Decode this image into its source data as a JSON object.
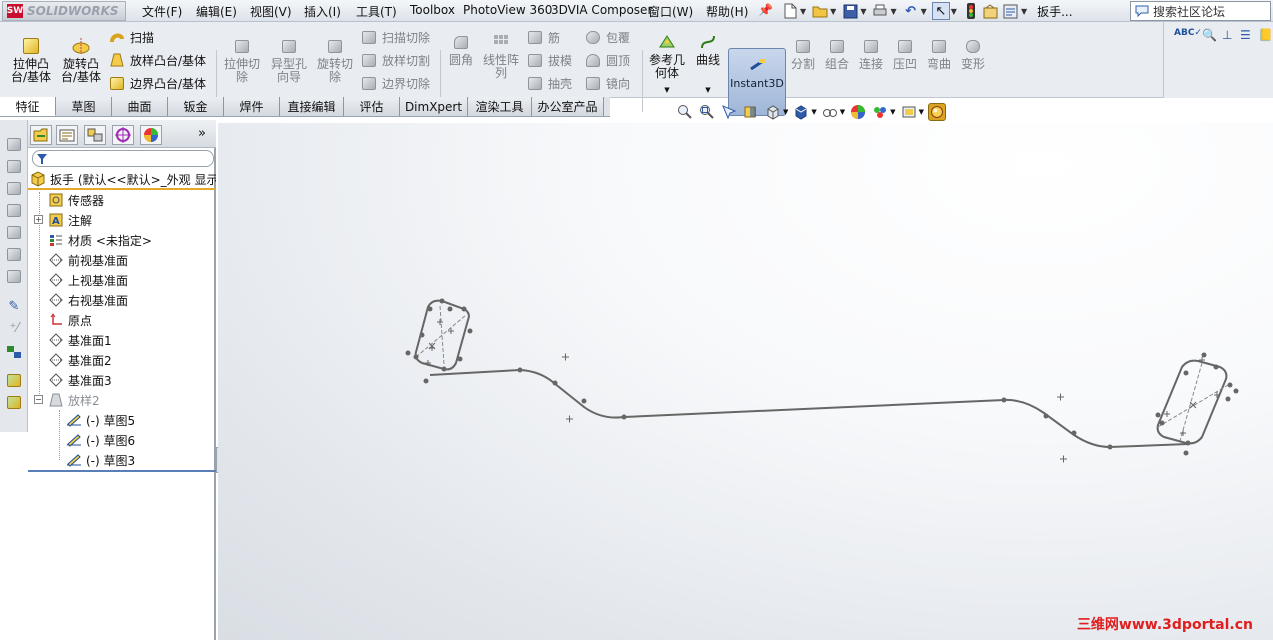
{
  "app": {
    "logo_text": "SOLIDWORKS",
    "logo_badge": "SW"
  },
  "menu": [
    "文件(F)",
    "编辑(E)",
    "视图(V)",
    "插入(I)",
    "工具(T)",
    "Toolbox",
    "PhotoView 360",
    "3DVIA Composer",
    "窗口(W)",
    "帮助(H)"
  ],
  "doc_title": "扳手...",
  "search": {
    "placeholder": "搜索社区论坛"
  },
  "commands": {
    "extrude_boss": "拉伸凸\n台/基体",
    "revolve_boss": "旋转凸\n台/基体",
    "sweep": "扫描",
    "loft_boss": "放样凸台/基体",
    "boundary_boss": "边界凸台/基体",
    "extrude_cut": "拉伸切\n除",
    "hole_wizard": "异型孔\n向导",
    "revolve_cut": "旋转切\n除",
    "swept_cut": "扫描切除",
    "lofted_cut": "放样切割",
    "boundary_cut": "边界切除",
    "fillet": "圆角",
    "linear_pattern": "线性阵\n列",
    "rib": "筋",
    "draft": "拔模",
    "shell": "抽壳",
    "wrap": "包覆",
    "dome": "圆顶",
    "mirror": "镜向",
    "ref_geometry": "参考几\n何体",
    "curves": "曲线",
    "instant3d": "Instant3D",
    "split": "分割",
    "combine": "组合",
    "join": "连接",
    "indent": "压凹",
    "flex": "弯曲",
    "deform": "变形"
  },
  "tabs": [
    "特征",
    "草图",
    "曲面",
    "钣金",
    "焊件",
    "直接编辑",
    "评估",
    "DimXpert",
    "渲染工具",
    "办公室产品"
  ],
  "feature_tree": {
    "part": "扳手  (默认<<默认>_外观 显示",
    "items": [
      {
        "label": "传感器",
        "icon": "sensor-icon"
      },
      {
        "label": "注解",
        "icon": "annotations-icon"
      },
      {
        "label": "材质 <未指定>",
        "icon": "material-icon"
      },
      {
        "label": "前视基准面",
        "icon": "plane-icon"
      },
      {
        "label": "上视基准面",
        "icon": "plane-icon"
      },
      {
        "label": "右视基准面",
        "icon": "plane-icon"
      },
      {
        "label": "原点",
        "icon": "origin-icon"
      },
      {
        "label": "基准面1",
        "icon": "plane-icon"
      },
      {
        "label": "基准面2",
        "icon": "plane-icon"
      },
      {
        "label": "基准面3",
        "icon": "plane-icon"
      },
      {
        "label": "放样2",
        "icon": "loft-icon"
      },
      {
        "label": "(-) 草图5",
        "icon": "sketch-icon"
      },
      {
        "label": "(-) 草图6",
        "icon": "sketch-icon"
      },
      {
        "label": "(-) 草图3",
        "icon": "sketch-icon"
      }
    ]
  },
  "watermark": "三维网www.3dportal.cn"
}
